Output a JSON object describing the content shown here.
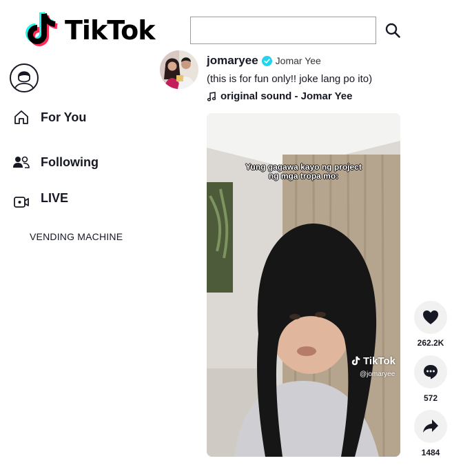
{
  "header": {
    "brand": "TikTok",
    "search": {
      "value": "",
      "placeholder": ""
    }
  },
  "sidebar": {
    "items": [
      {
        "label": "For You",
        "icon": "home-icon"
      },
      {
        "label": "Following",
        "icon": "people-icon"
      },
      {
        "label": "LIVE",
        "icon": "live-camera-icon"
      }
    ],
    "extra_link": "VENDING MACHINE"
  },
  "post": {
    "username": "jomaryee",
    "nickname": "Jomar Yee",
    "caption": "(this is for fun only!! joke lang po ito)",
    "music": "original sound - Jomar Yee",
    "video": {
      "overlay_line1": "Yung gagawa kayo ng project",
      "overlay_line2": "ng mga tropa mo:",
      "watermark_brand": "TikTok",
      "watermark_handle": "@jomaryee"
    }
  },
  "actions": {
    "likes": "262.2K",
    "comments": "572",
    "shares": "1484"
  },
  "colors": {
    "brand_cyan": "#25F4EE",
    "brand_red": "#FE2C55",
    "verified_blue": "#20D5EC",
    "text_primary": "#161823"
  }
}
